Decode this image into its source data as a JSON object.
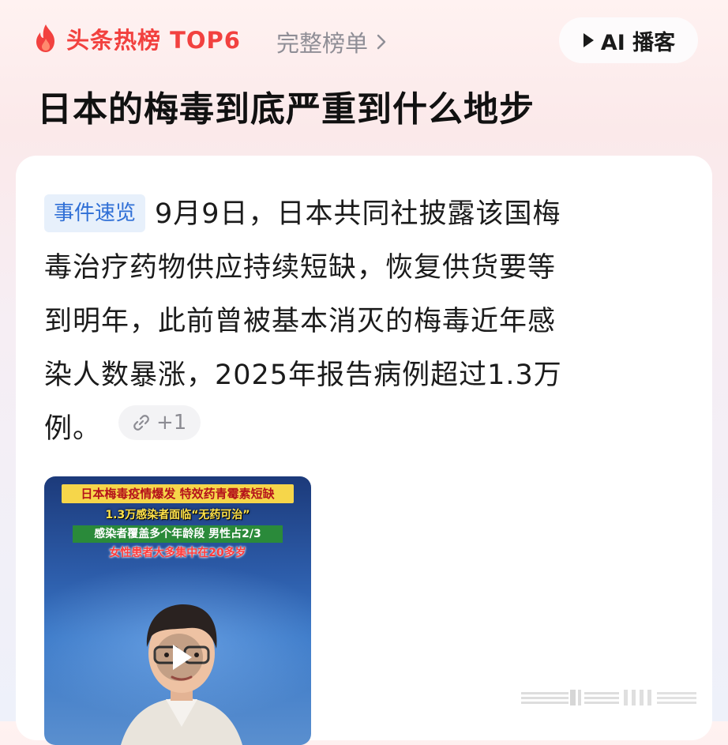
{
  "header": {
    "brand": "头条热榜 TOP6",
    "full_list_label": "完整榜单",
    "ai_podcast_label": "AI 播客"
  },
  "topic": {
    "title": "日本的梅毒到底严重到什么地步"
  },
  "summary": {
    "tag": "事件速览",
    "lines": [
      "9月9日，日本共同社披露该国梅",
      "毒治疗药物供应持续短缺，恢复供货要等",
      "到明年，此前曾被基本消灭的梅毒近年感",
      "染人数暴涨，2025年报告病例超过1.3万",
      "例。"
    ],
    "source_count": "+1"
  },
  "video": {
    "caption_1": "日本梅毒疫情爆发 特效药青霉素短缺",
    "caption_2": "1.3万感染者面临“无药可治”",
    "caption_3": "感染者覆盖多个年龄段 男性占2/3",
    "caption_4": "女性患者大多集中在20多岁"
  },
  "colors": {
    "brand_red": "#f2413f",
    "tag_blue": "#2f6fd6",
    "tag_bg": "#e7f0fb"
  },
  "icons": [
    "flame-icon",
    "chevron-right-icon",
    "play-icon",
    "link-icon",
    "video-play-icon"
  ]
}
